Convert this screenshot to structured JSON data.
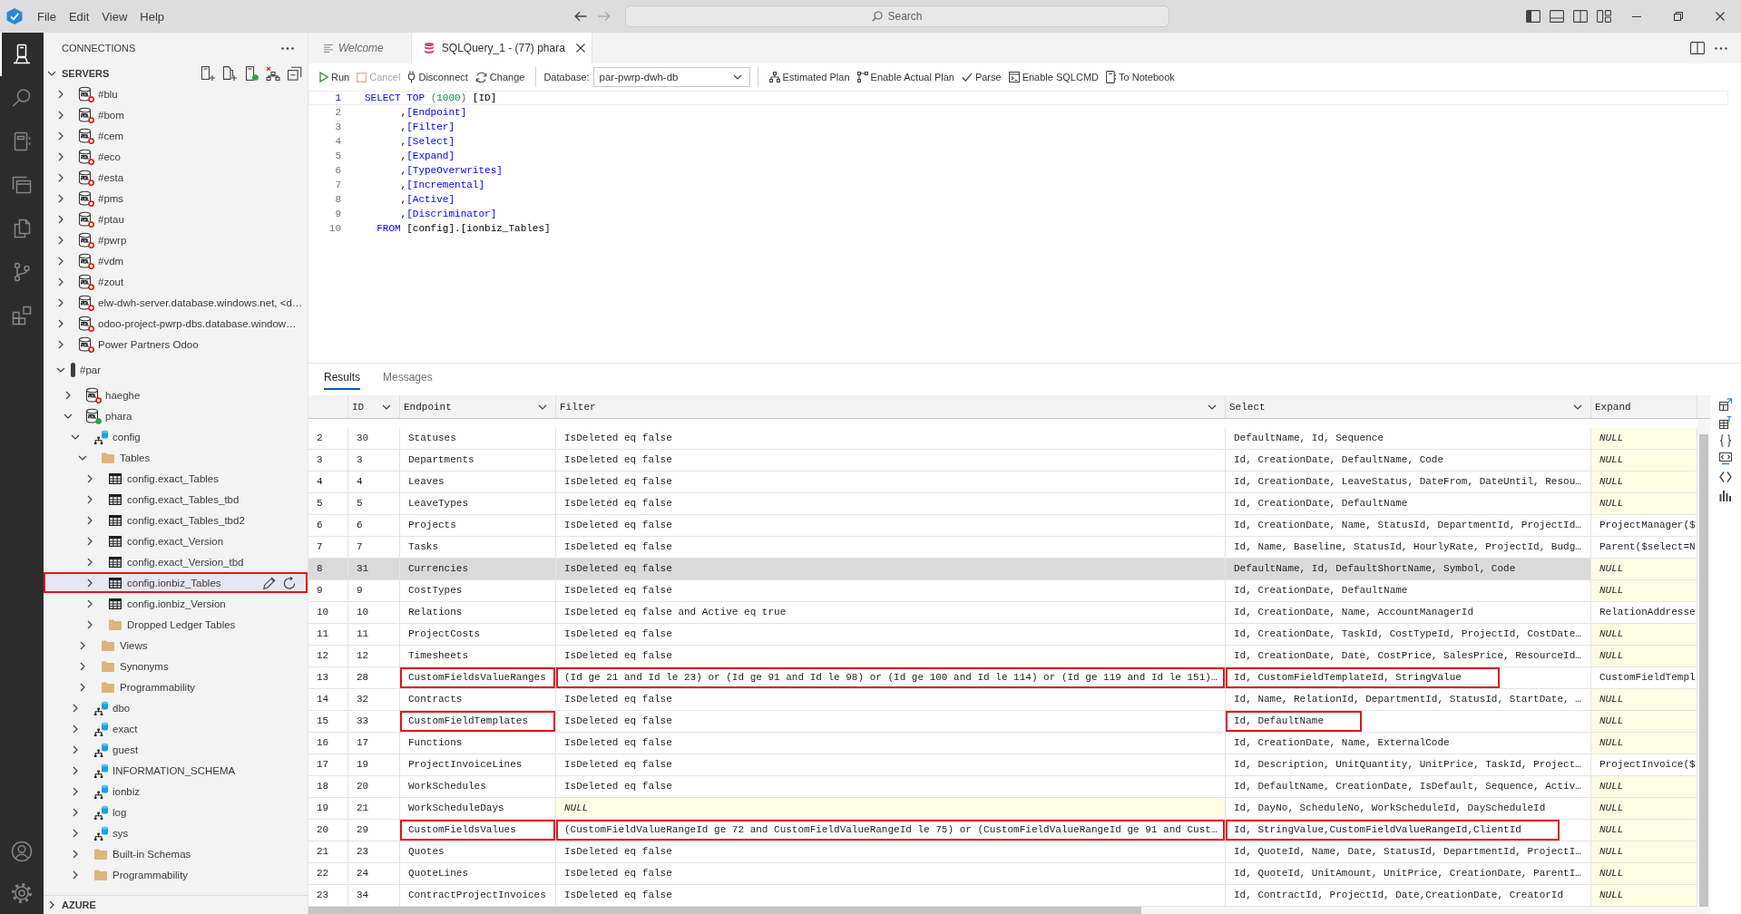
{
  "title_bar": {
    "menu": [
      "File",
      "Edit",
      "View",
      "Help"
    ],
    "command_center": {
      "label": "Search"
    }
  },
  "activity_bar": {
    "items": [
      {
        "selected": true
      },
      {
        "selected": false
      },
      {
        "selected": false
      },
      {
        "selected": false
      },
      {
        "selected": false
      },
      {
        "selected": false
      },
      {
        "selected": false
      }
    ]
  },
  "sidebar": {
    "title": "CONNECTIONS",
    "sections": [
      {
        "title": "SERVERS",
        "expanded": true,
        "items": [
          {
            "label": "#blu",
            "kind": "server",
            "connected": false,
            "expanded": false,
            "selected": false,
            "highlighted": false
          },
          {
            "label": "#bom",
            "kind": "server",
            "connected": false,
            "expanded": false,
            "selected": false,
            "highlighted": false
          },
          {
            "label": "#cem",
            "kind": "server",
            "connected": false,
            "expanded": false,
            "selected": false,
            "highlighted": false
          },
          {
            "label": "#eco",
            "kind": "server",
            "connected": false,
            "expanded": false,
            "selected": false,
            "highlighted": false
          },
          {
            "label": "#esta",
            "kind": "server",
            "connected": false,
            "expanded": false,
            "selected": false,
            "highlighted": false
          },
          {
            "label": "#pms",
            "kind": "server",
            "connected": false,
            "expanded": false,
            "selected": false,
            "highlighted": false
          },
          {
            "label": "#ptau",
            "kind": "server",
            "connected": false,
            "expanded": false,
            "selected": false,
            "highlighted": false
          },
          {
            "label": "#pwrp",
            "kind": "server",
            "connected": false,
            "expanded": false,
            "selected": false,
            "highlighted": false
          },
          {
            "label": "#vdm",
            "kind": "server",
            "connected": false,
            "expanded": false,
            "selected": false,
            "highlighted": false
          },
          {
            "label": "#zout",
            "kind": "server",
            "connected": false,
            "expanded": false,
            "selected": false,
            "highlighted": false
          },
          {
            "label": "elw-dwh-server.database.windows.net, <d…",
            "kind": "server",
            "connected": false,
            "expanded": false,
            "selected": false,
            "highlighted": false
          },
          {
            "label": "odoo-project-pwrp-dbs.database.window…",
            "kind": "server",
            "connected": false,
            "expanded": false,
            "selected": false,
            "highlighted": false
          },
          {
            "label": "Power Partners Odoo",
            "kind": "server",
            "connected": false,
            "expanded": false,
            "selected": false,
            "highlighted": false
          },
          {
            "label": "#par",
            "kind": "group",
            "expanded": true,
            "selected": false,
            "highlighted": false,
            "children": [
              {
                "label": "haeghe",
                "kind": "server",
                "connected": false,
                "expanded": false,
                "selected": false,
                "highlighted": false
              },
              {
                "label": "phara",
                "kind": "server",
                "connected": true,
                "expanded": true,
                "selected": false,
                "highlighted": false,
                "children": [
                  {
                    "label": "config",
                    "kind": "schema",
                    "expanded": true,
                    "selected": false,
                    "highlighted": false,
                    "children": [
                      {
                        "label": "Tables",
                        "kind": "folder",
                        "expanded": true,
                        "selected": false,
                        "highlighted": false,
                        "children": [
                          {
                            "label": "config.exact_Tables",
                            "kind": "table",
                            "expanded": false,
                            "selected": false,
                            "highlighted": false
                          },
                          {
                            "label": "config.exact_Tables_tbd",
                            "kind": "table",
                            "expanded": false,
                            "selected": false,
                            "highlighted": false
                          },
                          {
                            "label": "config.exact_Tables_tbd2",
                            "kind": "table",
                            "expanded": false,
                            "selected": false,
                            "highlighted": false
                          },
                          {
                            "label": "config.exact_Version",
                            "kind": "table",
                            "expanded": false,
                            "selected": false,
                            "highlighted": false
                          },
                          {
                            "label": "config.exact_Version_tbd",
                            "kind": "table",
                            "expanded": false,
                            "selected": false,
                            "highlighted": false
                          },
                          {
                            "label": "config.ionbiz_Tables",
                            "kind": "table",
                            "expanded": false,
                            "selected": true,
                            "highlighted": true
                          },
                          {
                            "label": "config.ionbiz_Version",
                            "kind": "table",
                            "expanded": false,
                            "selected": false,
                            "highlighted": false
                          },
                          {
                            "label": "Dropped Ledger Tables",
                            "kind": "folder",
                            "expanded": false,
                            "selected": false,
                            "highlighted": false
                          }
                        ]
                      },
                      {
                        "label": "Views",
                        "kind": "folder",
                        "expanded": false,
                        "selected": false,
                        "highlighted": false
                      },
                      {
                        "label": "Synonyms",
                        "kind": "folder",
                        "expanded": false,
                        "selected": false,
                        "highlighted": false
                      },
                      {
                        "label": "Programmability",
                        "kind": "folder",
                        "expanded": false,
                        "selected": false,
                        "highlighted": false
                      }
                    ]
                  },
                  {
                    "label": "dbo",
                    "kind": "schema",
                    "expanded": false,
                    "selected": false,
                    "highlighted": false
                  },
                  {
                    "label": "exact",
                    "kind": "schema",
                    "expanded": false,
                    "selected": false,
                    "highlighted": false
                  },
                  {
                    "label": "guest",
                    "kind": "schema",
                    "expanded": false,
                    "selected": false,
                    "highlighted": false
                  },
                  {
                    "label": "INFORMATION_SCHEMA",
                    "kind": "schema",
                    "expanded": false,
                    "selected": false,
                    "highlighted": false
                  },
                  {
                    "label": "ionbiz",
                    "kind": "schema",
                    "expanded": false,
                    "selected": false,
                    "highlighted": false
                  },
                  {
                    "label": "log",
                    "kind": "schema",
                    "expanded": false,
                    "selected": false,
                    "highlighted": false
                  },
                  {
                    "label": "sys",
                    "kind": "schema",
                    "expanded": false,
                    "selected": false,
                    "highlighted": false
                  },
                  {
                    "label": "Built-in Schemas",
                    "kind": "folder",
                    "expanded": false,
                    "selected": false,
                    "highlighted": false
                  },
                  {
                    "label": "Programmability",
                    "kind": "folder",
                    "expanded": false,
                    "selected": false,
                    "highlighted": false
                  }
                ]
              }
            ]
          }
        ]
      },
      {
        "title": "AZURE",
        "expanded": false
      }
    ]
  },
  "editor": {
    "tabs": [
      {
        "label": "Welcome",
        "kind": "preview",
        "selected": false
      },
      {
        "label": "SQLQuery_1 - (77) phara",
        "kind": "query",
        "selected": true
      }
    ],
    "toolbar": {
      "buttons": [
        {
          "label": "Run",
          "disabled": false
        },
        {
          "label": "Cancel",
          "disabled": true
        },
        {
          "label": "Disconnect",
          "disabled": false
        },
        {
          "label": "Change",
          "disabled": false
        }
      ],
      "database": {
        "label": "Database:",
        "value": "par-pwrp-dwh-db"
      },
      "actions": [
        "Estimated Plan",
        "Enable Actual Plan",
        "Parse",
        "Enable SQLCMD",
        "To Notebook"
      ]
    },
    "code": {
      "lines": [
        {
          "number": "1",
          "current": true,
          "tokens": [
            {
              "text": "SELECT TOP ",
              "kind": "keyword"
            },
            {
              "text": "(",
              "kind": "operator"
            },
            {
              "text": "1000",
              "kind": "number"
            },
            {
              "text": ")",
              "kind": "operator"
            },
            {
              "text": " [ID]",
              "kind": "plain"
            }
          ]
        },
        {
          "number": "2",
          "current": false,
          "tokens": [
            {
              "text": "      ,",
              "kind": "plain"
            },
            {
              "text": "[Endpoint]",
              "kind": "keyword"
            }
          ]
        },
        {
          "number": "3",
          "current": false,
          "tokens": [
            {
              "text": "      ,",
              "kind": "plain"
            },
            {
              "text": "[Filter]",
              "kind": "keyword"
            }
          ]
        },
        {
          "number": "4",
          "current": false,
          "tokens": [
            {
              "text": "      ,",
              "kind": "plain"
            },
            {
              "text": "[Select]",
              "kind": "keyword"
            }
          ]
        },
        {
          "number": "5",
          "current": false,
          "tokens": [
            {
              "text": "      ,",
              "kind": "plain"
            },
            {
              "text": "[Expand]",
              "kind": "keyword"
            }
          ]
        },
        {
          "number": "6",
          "current": false,
          "tokens": [
            {
              "text": "      ,",
              "kind": "plain"
            },
            {
              "text": "[TypeOverwrites]",
              "kind": "keyword"
            }
          ]
        },
        {
          "number": "7",
          "current": false,
          "tokens": [
            {
              "text": "      ,",
              "kind": "plain"
            },
            {
              "text": "[Incremental]",
              "kind": "keyword"
            }
          ]
        },
        {
          "number": "8",
          "current": false,
          "tokens": [
            {
              "text": "      ,",
              "kind": "plain"
            },
            {
              "text": "[Active]",
              "kind": "keyword"
            }
          ]
        },
        {
          "number": "9",
          "current": false,
          "tokens": [
            {
              "text": "      ,",
              "kind": "plain"
            },
            {
              "text": "[Discriminator]",
              "kind": "keyword"
            }
          ]
        },
        {
          "number": "10",
          "current": false,
          "tokens": [
            {
              "text": "  FROM ",
              "kind": "keyword"
            },
            {
              "text": "[config].[ionbiz_Tables]",
              "kind": "plain"
            }
          ]
        }
      ]
    }
  },
  "results": {
    "tabs": [
      {
        "label": "Results",
        "selected": true
      },
      {
        "label": "Messages",
        "selected": false
      }
    ],
    "grid": {
      "columns": [
        {
          "label": "ID",
          "dropdown": true
        },
        {
          "label": "Endpoint",
          "dropdown": true
        },
        {
          "label": "Filter",
          "dropdown": true
        },
        {
          "label": "Select",
          "dropdown": true
        },
        {
          "label": "Expand",
          "dropdown": false
        }
      ],
      "rows": [
        {
          "number": "2",
          "selected": false,
          "cells": [
            {
              "text": "30",
              "null": false,
              "outlined": false
            },
            {
              "text": "Statuses",
              "null": false,
              "outlined": false
            },
            {
              "text": "IsDeleted eq false",
              "null": false,
              "outlined": false
            },
            {
              "text": "DefaultName, Id, Sequence",
              "null": false,
              "outlined": false
            },
            {
              "text": "NULL",
              "null": true,
              "outlined": false
            }
          ]
        },
        {
          "number": "3",
          "selected": false,
          "cells": [
            {
              "text": "3",
              "null": false,
              "outlined": false
            },
            {
              "text": "Departments",
              "null": false,
              "outlined": false
            },
            {
              "text": "IsDeleted eq false",
              "null": false,
              "outlined": false
            },
            {
              "text": "Id, CreationDate, DefaultName, Code",
              "null": false,
              "outlined": false
            },
            {
              "text": "NULL",
              "null": true,
              "outlined": false
            }
          ]
        },
        {
          "number": "4",
          "selected": false,
          "cells": [
            {
              "text": "4",
              "null": false,
              "outlined": false
            },
            {
              "text": "Leaves",
              "null": false,
              "outlined": false
            },
            {
              "text": "IsDeleted eq false",
              "null": false,
              "outlined": false
            },
            {
              "text": "Id, CreationDate, LeaveStatus, DateFrom, DateUntil, Resou…",
              "null": false,
              "outlined": false
            },
            {
              "text": "NULL",
              "null": true,
              "outlined": false
            }
          ]
        },
        {
          "number": "5",
          "selected": false,
          "cells": [
            {
              "text": "5",
              "null": false,
              "outlined": false
            },
            {
              "text": "LeaveTypes",
              "null": false,
              "outlined": false
            },
            {
              "text": "IsDeleted eq false",
              "null": false,
              "outlined": false
            },
            {
              "text": "Id, CreationDate, DefaultName",
              "null": false,
              "outlined": false
            },
            {
              "text": "NULL",
              "null": true,
              "outlined": false
            }
          ]
        },
        {
          "number": "6",
          "selected": false,
          "cells": [
            {
              "text": "6",
              "null": false,
              "outlined": false
            },
            {
              "text": "Projects",
              "null": false,
              "outlined": false
            },
            {
              "text": "IsDeleted eq false",
              "null": false,
              "outlined": false
            },
            {
              "text": "Id, CreationDate, Name, StatusId, DepartmentId, ProjectId…",
              "null": false,
              "outlined": false
            },
            {
              "text": "ProjectManager($",
              "null": false,
              "outlined": false
            }
          ]
        },
        {
          "number": "7",
          "selected": false,
          "cells": [
            {
              "text": "7",
              "null": false,
              "outlined": false
            },
            {
              "text": "Tasks",
              "null": false,
              "outlined": false
            },
            {
              "text": "IsDeleted eq false",
              "null": false,
              "outlined": false
            },
            {
              "text": "Id, Name, Baseline, StatusId, HourlyRate, ProjectId, Budg…",
              "null": false,
              "outlined": false
            },
            {
              "text": "Parent($select=N",
              "null": false,
              "outlined": false
            }
          ]
        },
        {
          "number": "8",
          "selected": true,
          "cells": [
            {
              "text": "31",
              "null": false,
              "outlined": false
            },
            {
              "text": "Currencies",
              "null": false,
              "outlined": false
            },
            {
              "text": "IsDeleted eq false",
              "null": false,
              "outlined": false
            },
            {
              "text": "DefaultName, Id, DefaultShortName, Symbol, Code",
              "null": false,
              "outlined": false
            },
            {
              "text": "NULL",
              "null": true,
              "outlined": false
            }
          ]
        },
        {
          "number": "9",
          "selected": false,
          "cells": [
            {
              "text": "9",
              "null": false,
              "outlined": false
            },
            {
              "text": "CostTypes",
              "null": false,
              "outlined": false
            },
            {
              "text": "IsDeleted eq false",
              "null": false,
              "outlined": false
            },
            {
              "text": "Id, CreationDate, DefaultName",
              "null": false,
              "outlined": false
            },
            {
              "text": "NULL",
              "null": true,
              "outlined": false
            }
          ]
        },
        {
          "number": "10",
          "selected": false,
          "cells": [
            {
              "text": "10",
              "null": false,
              "outlined": false
            },
            {
              "text": "Relations",
              "null": false,
              "outlined": false
            },
            {
              "text": "IsDeleted eq false and Active eq true",
              "null": false,
              "outlined": false
            },
            {
              "text": "Id, CreationDate, Name, AccountManagerId",
              "null": false,
              "outlined": false
            },
            {
              "text": "RelationAddresse",
              "null": false,
              "outlined": false
            }
          ]
        },
        {
          "number": "11",
          "selected": false,
          "cells": [
            {
              "text": "11",
              "null": false,
              "outlined": false
            },
            {
              "text": "ProjectCosts",
              "null": false,
              "outlined": false
            },
            {
              "text": "IsDeleted eq false",
              "null": false,
              "outlined": false
            },
            {
              "text": "Id, CreationDate, TaskId, CostTypeId, ProjectId, CostDate…",
              "null": false,
              "outlined": false
            },
            {
              "text": "NULL",
              "null": true,
              "outlined": false
            }
          ]
        },
        {
          "number": "12",
          "selected": false,
          "cells": [
            {
              "text": "12",
              "null": false,
              "outlined": false
            },
            {
              "text": "Timesheets",
              "null": false,
              "outlined": false
            },
            {
              "text": "IsDeleted eq false",
              "null": false,
              "outlined": false
            },
            {
              "text": "Id, CreationDate, Date, CostPrice, SalesPrice, ResourceId…",
              "null": false,
              "outlined": false
            },
            {
              "text": "NULL",
              "null": true,
              "outlined": false
            }
          ]
        },
        {
          "number": "13",
          "selected": false,
          "cells": [
            {
              "text": "28",
              "null": false,
              "outlined": false
            },
            {
              "text": "CustomFieldsValueRanges",
              "null": false,
              "outlined": true
            },
            {
              "text": "(Id ge 21 and Id le 23) or (Id ge 91 and Id le 98) or (Id ge 100 and Id le 114) or (Id ge 119 and Id le 151)…",
              "null": false,
              "outlined": true
            },
            {
              "text": "Id, CustomFieldTemplateId, StringValue",
              "null": false,
              "outlined": true
            },
            {
              "text": "CustomFieldTempl",
              "null": false,
              "outlined": false
            }
          ]
        },
        {
          "number": "14",
          "selected": false,
          "cells": [
            {
              "text": "32",
              "null": false,
              "outlined": false
            },
            {
              "text": "Contracts",
              "null": false,
              "outlined": false
            },
            {
              "text": "IsDeleted eq false",
              "null": false,
              "outlined": false
            },
            {
              "text": "Id, Name, RelationId, DepartmentId, StatusId, StartDate, …",
              "null": false,
              "outlined": false
            },
            {
              "text": "NULL",
              "null": true,
              "outlined": false
            }
          ]
        },
        {
          "number": "15",
          "selected": false,
          "cells": [
            {
              "text": "33",
              "null": false,
              "outlined": false
            },
            {
              "text": "CustomFieldTemplates",
              "null": false,
              "outlined": true
            },
            {
              "text": "IsDeleted eq false",
              "null": false,
              "outlined": false
            },
            {
              "text": "Id, DefaultName",
              "null": false,
              "outlined": true
            },
            {
              "text": "NULL",
              "null": true,
              "outlined": false
            }
          ]
        },
        {
          "number": "16",
          "selected": false,
          "cells": [
            {
              "text": "17",
              "null": false,
              "outlined": false
            },
            {
              "text": "Functions",
              "null": false,
              "outlined": false
            },
            {
              "text": "IsDeleted eq false",
              "null": false,
              "outlined": false
            },
            {
              "text": "Id, CreationDate, Name, ExternalCode",
              "null": false,
              "outlined": false
            },
            {
              "text": "NULL",
              "null": true,
              "outlined": false
            }
          ]
        },
        {
          "number": "17",
          "selected": false,
          "cells": [
            {
              "text": "19",
              "null": false,
              "outlined": false
            },
            {
              "text": "ProjectInvoiceLines",
              "null": false,
              "outlined": false
            },
            {
              "text": "IsDeleted eq false",
              "null": false,
              "outlined": false
            },
            {
              "text": "Id, Description, UnitQuantity, UnitPrice, TaskId, Project…",
              "null": false,
              "outlined": false
            },
            {
              "text": "ProjectInvoice($",
              "null": false,
              "outlined": false
            }
          ]
        },
        {
          "number": "18",
          "selected": false,
          "cells": [
            {
              "text": "20",
              "null": false,
              "outlined": false
            },
            {
              "text": "WorkSchedules",
              "null": false,
              "outlined": false
            },
            {
              "text": "IsDeleted eq false",
              "null": false,
              "outlined": false
            },
            {
              "text": "Id, DefaultName, CreationDate, IsDefault, Sequence, Activ…",
              "null": false,
              "outlined": false
            },
            {
              "text": "NULL",
              "null": true,
              "outlined": false
            }
          ]
        },
        {
          "number": "19",
          "selected": false,
          "cells": [
            {
              "text": "21",
              "null": false,
              "outlined": false
            },
            {
              "text": "WorkScheduleDays",
              "null": false,
              "outlined": false
            },
            {
              "text": "NULL",
              "null": true,
              "outlined": false
            },
            {
              "text": "Id, DayNo, ScheduleNo, WorkScheduleId, DayScheduleId",
              "null": false,
              "outlined": false
            },
            {
              "text": "NULL",
              "null": true,
              "outlined": false
            }
          ]
        },
        {
          "number": "20",
          "selected": false,
          "cells": [
            {
              "text": "29",
              "null": false,
              "outlined": false
            },
            {
              "text": "CustomFieldsValues",
              "null": false,
              "outlined": true
            },
            {
              "text": "(CustomFieldValueRangeId ge 72 and CustomFieldValueRangeId le 75) or (CustomFieldValueRangeId ge 91 and Cust…",
              "null": false,
              "outlined": true
            },
            {
              "text": "Id, StringValue,CustomFieldValueRangeId,ClientId",
              "null": false,
              "outlined": true
            },
            {
              "text": "NULL",
              "null": true,
              "outlined": false
            }
          ]
        },
        {
          "number": "21",
          "selected": false,
          "cells": [
            {
              "text": "23",
              "null": false,
              "outlined": false
            },
            {
              "text": "Quotes",
              "null": false,
              "outlined": false
            },
            {
              "text": "IsDeleted eq false",
              "null": false,
              "outlined": false
            },
            {
              "text": "Id, QuoteId, Name, Date, StatusId, DepartmentId, ProjectI…",
              "null": false,
              "outlined": false
            },
            {
              "text": "NULL",
              "null": true,
              "outlined": false
            }
          ]
        },
        {
          "number": "22",
          "selected": false,
          "cells": [
            {
              "text": "24",
              "null": false,
              "outlined": false
            },
            {
              "text": "QuoteLines",
              "null": false,
              "outlined": false
            },
            {
              "text": "IsDeleted eq false",
              "null": false,
              "outlined": false
            },
            {
              "text": "Id, QuoteId, UnitAmount, UnitPrice, CreationDate, ParentI…",
              "null": false,
              "outlined": false
            },
            {
              "text": "NULL",
              "null": true,
              "outlined": false
            }
          ]
        },
        {
          "number": "23",
          "selected": false,
          "cells": [
            {
              "text": "34",
              "null": false,
              "outlined": false
            },
            {
              "text": "ContractProjectInvoices",
              "null": false,
              "outlined": false
            },
            {
              "text": "IsDeleted eq false",
              "null": false,
              "outlined": false
            },
            {
              "text": "Id, ContractId, ProjectId, Date,CreationDate, CreatorId",
              "null": false,
              "outlined": false
            },
            {
              "text": "NULL",
              "null": true,
              "outlined": false
            }
          ]
        }
      ]
    }
  }
}
